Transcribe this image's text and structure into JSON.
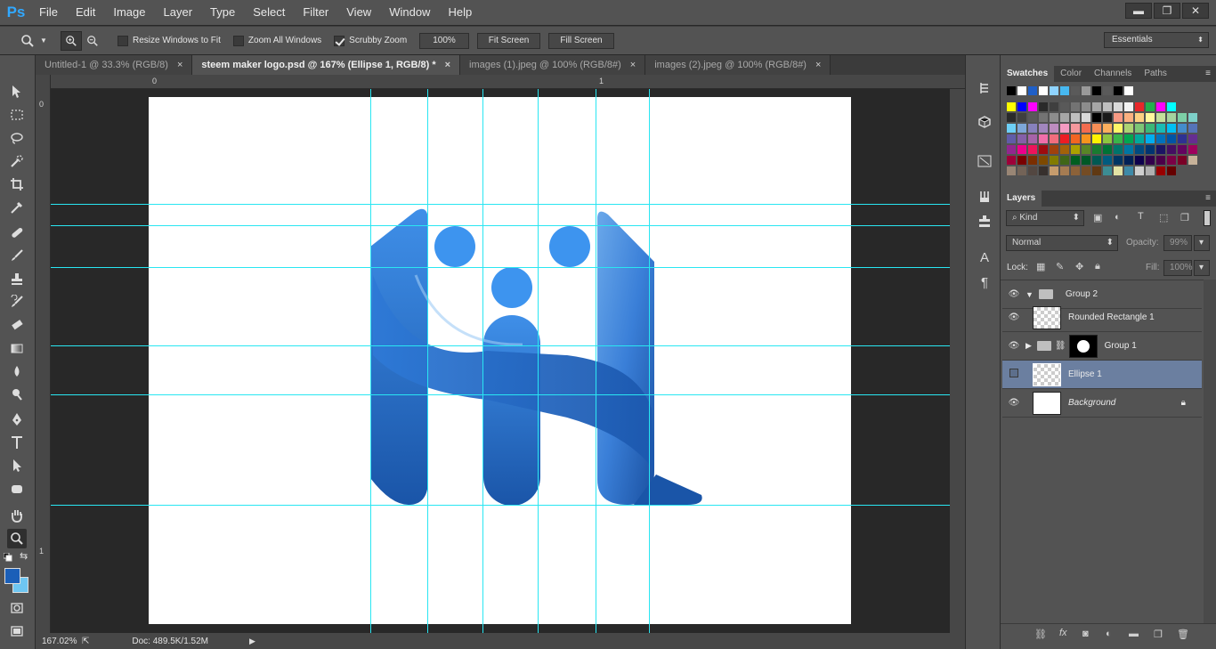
{
  "app": {
    "logo": "Ps"
  },
  "menu": [
    "File",
    "Edit",
    "Image",
    "Layer",
    "Type",
    "Select",
    "Filter",
    "View",
    "Window",
    "Help"
  ],
  "window_controls": {
    "minimize": "▬",
    "restore": "❐",
    "close": "✕"
  },
  "options": {
    "resize_windows": "Resize Windows to Fit",
    "zoom_all": "Zoom All Windows",
    "scrubby": "Scrubby Zoom",
    "btn_100": "100%",
    "fit_screen": "Fit Screen",
    "fill_screen": "Fill Screen",
    "workspace": "Essentials",
    "resize_checked": false,
    "zoom_all_checked": false,
    "scrubby_checked": true
  },
  "tabs": [
    {
      "label": "Untitled-1 @ 33.3% (RGB/8)",
      "close": "×",
      "active": false
    },
    {
      "label": "steem maker logo.psd @ 167% (Ellipse 1, RGB/8) *",
      "close": "×",
      "active": true
    },
    {
      "label": "images (1).jpeg @ 100% (RGB/8#)",
      "close": "×",
      "active": false
    },
    {
      "label": "images (2).jpeg @ 100% (RGB/8#)",
      "close": "×",
      "active": false
    }
  ],
  "rulers": {
    "h": [
      "0",
      "1"
    ],
    "v": [
      "0",
      "1"
    ]
  },
  "status": {
    "zoom": "167.02%",
    "doc": "Doc: 489.5K/1.52M"
  },
  "swatches_panel": {
    "tabs": [
      "Swatches",
      "Color",
      "Channels",
      "Paths"
    ]
  },
  "swatch_colors": [
    [
      "#000000",
      "#ffffff",
      "#1f5fc7",
      "#ffffff",
      "#8fd3ff",
      "#47b8f0",
      "#5a5a5a",
      "#9a9a9a",
      "#000000",
      "#5a5a5a",
      "#000000",
      "#ffffff"
    ],
    [
      "#ffff00",
      "#0000ff",
      "#ff00ff",
      "#2a2a2a",
      "#3f3f3f",
      "#595959",
      "#737373",
      "#8c8c8c",
      "#a6a6a6",
      "#bfbfbf",
      "#d9d9d9",
      "#f2f2f2",
      "#e8272a",
      "#22b14c",
      "#ff00ff",
      "#00ffff"
    ],
    [
      "#2a2a2a",
      "#3f3f3f",
      "#595959",
      "#737373",
      "#8c8c8c",
      "#a6a6a6",
      "#bfbfbf",
      "#d9d9d9",
      "#000000",
      "#1a1a1a",
      "#f79a84",
      "#fbb080",
      "#fdd082",
      "#fff99d",
      "#c4df9b",
      "#a4d39e",
      "#7ccfa6",
      "#7dd0c9"
    ],
    [
      "#6dcff6",
      "#7da7d9",
      "#8781bd",
      "#a186be",
      "#bd8cbf",
      "#f49ac1",
      "#f5989d",
      "#f26c4f",
      "#f68e56",
      "#fbaf5d",
      "#fff568",
      "#acd373",
      "#7cc576",
      "#3bb878",
      "#1abbb4",
      "#00bff3",
      "#448ccb",
      "#5574b9"
    ],
    [
      "#605ca8",
      "#855fa8",
      "#a763a8",
      "#f06eaa",
      "#f26d7d",
      "#ed1c24",
      "#f26522",
      "#f7941d",
      "#fff200",
      "#8dc63f",
      "#39b54a",
      "#00a651",
      "#00a99d",
      "#00aeef",
      "#0072bc",
      "#0054a6",
      "#2e3192",
      "#662d91"
    ],
    [
      "#92278f",
      "#ec008c",
      "#ed145b",
      "#9e0b0f",
      "#a0410d",
      "#a36209",
      "#aba000",
      "#598527",
      "#197b30",
      "#007236",
      "#00746b",
      "#0076a3",
      "#004a80",
      "#003471",
      "#1b1464",
      "#440e62",
      "#630460",
      "#9e005d"
    ],
    [
      "#9e0039",
      "#790000",
      "#7b2e00",
      "#7d4900",
      "#827b00",
      "#406618",
      "#005e20",
      "#005826",
      "#005952",
      "#005b7f",
      "#003663",
      "#002157",
      "#0d004c",
      "#32004b",
      "#4b0049",
      "#7b0046",
      "#7a0026",
      "#c7b299"
    ],
    [
      "#998675",
      "#736357",
      "#534741",
      "#37302d",
      "#c69c6d",
      "#a67c52",
      "#8c6239",
      "#754c24",
      "#603913",
      "#3c8c93",
      "#e3e3a4",
      "#3e8aa8",
      "#cfcfcf",
      "#b0b0b0",
      "#990000",
      "#660000"
    ]
  ],
  "layers_panel": {
    "tab": "Layers",
    "kind": "Kind",
    "blend": "Normal",
    "opacity_label": "Opacity:",
    "opacity": "99%",
    "lock_label": "Lock:",
    "fill_label": "Fill:",
    "fill": "100%"
  },
  "layers": [
    {
      "name": "Group 2"
    },
    {
      "name": "Rounded Rectangle 1"
    },
    {
      "name": "Group 1"
    },
    {
      "name": "Ellipse 1"
    },
    {
      "name": "Background"
    }
  ],
  "colors": {
    "foreground": "#1b5fb8",
    "background": "#6ec6f2",
    "guide": "#29e6f2",
    "selected_layer": "#6b7fa0"
  }
}
